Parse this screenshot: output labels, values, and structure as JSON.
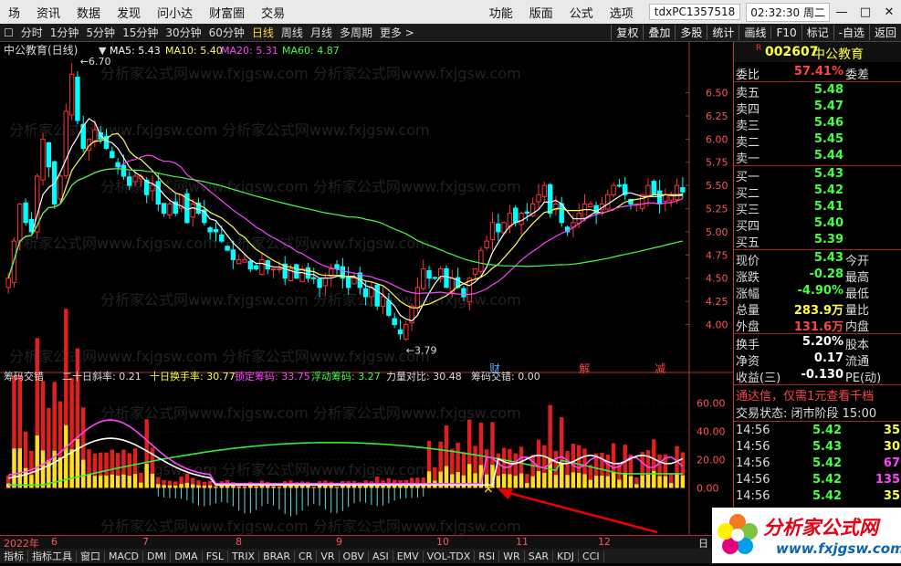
{
  "menu": [
    "场",
    "资讯",
    "数据",
    "发现",
    "问小达",
    "财富圈",
    "交易"
  ],
  "menu_right": [
    "功能",
    "版面",
    "公式",
    "选项"
  ],
  "account": "tdxPC1357518",
  "clock": "02:32:30 周二",
  "window_controls": [
    "—",
    "□",
    "✕"
  ],
  "periods": [
    "分时",
    "1分钟",
    "5分钟",
    "15分钟",
    "30分钟",
    "60分钟",
    "日线",
    "周线",
    "月线",
    "多周期",
    "更多 >"
  ],
  "active_period": "日线",
  "tools": [
    "复权",
    "叠加",
    "多股",
    "统计",
    "画线",
    "F10",
    "标记",
    "-自选",
    "返回"
  ],
  "stock_code": "002607",
  "stock_name": "中公教育",
  "kline_title": "中公教育(日线)",
  "ma": [
    {
      "label": "MA5: 5.43",
      "color": "#ffffff"
    },
    {
      "label": "MA10: 5.40",
      "color": "#ffff55"
    },
    {
      "label": "MA20: 5.31",
      "color": "#ff44ff"
    },
    {
      "label": "MA60: 4.87",
      "color": "#44ff44"
    }
  ],
  "high_mark": "6.70",
  "low_mark": "←3.79",
  "markers": [
    {
      "text": "财",
      "color": "#4da6ff",
      "date": "10月27日"
    },
    {
      "text": "解",
      "color": "#ff4444",
      "date": "11月17日"
    },
    {
      "text": "减",
      "color": "#ff4444",
      "date": "12月22日"
    }
  ],
  "indicator": {
    "name": "筹码交错",
    "items": [
      {
        "label": "二十日斜率: 0.21",
        "color": "#dddddd"
      },
      {
        "label": "十日换手率: 30.77",
        "color": "#ffff44"
      },
      {
        "label": "锁定筹码: 33.75",
        "color": "#ff44ff"
      },
      {
        "label": "浮动筹码: 3.27",
        "color": "#44ff44"
      },
      {
        "label": "力量对比: 30.48",
        "color": "#dddddd"
      },
      {
        "label": "筹码交错: 0.00",
        "color": "#dddddd"
      }
    ]
  },
  "price_axis": [
    "6.50",
    "6.25",
    "6.00",
    "5.75",
    "5.50",
    "5.25",
    "5.00",
    "4.75",
    "4.50",
    "4.25",
    "4.00"
  ],
  "ind_axis": [
    "60.00",
    "40.00",
    "20.00",
    "0.00"
  ],
  "date_axis": [
    "2022年",
    "6",
    "7",
    "8",
    "9",
    "10",
    "11",
    "12"
  ],
  "year_label": "日",
  "chart_data": {
    "type": "candlestick",
    "xlabel": "",
    "ylabel": "",
    "ylim": [
      3.7,
      6.85
    ],
    "x_ticks": [
      "2022年",
      "6",
      "7",
      "8",
      "9",
      "10",
      "11",
      "12"
    ],
    "price_path": [
      4.5,
      4.9,
      5.3,
      5.1,
      5.0,
      5.6,
      6.0,
      5.7,
      5.3,
      5.6,
      6.3,
      6.7,
      6.2,
      5.9,
      6.0,
      6.1,
      6.0,
      5.9,
      5.8,
      5.7,
      5.6,
      5.5,
      5.6,
      5.6,
      5.4,
      5.5,
      5.3,
      5.2,
      5.3,
      5.2,
      5.4,
      5.1,
      5.3,
      5.2,
      5.1,
      5.0,
      5.0,
      4.9,
      4.8,
      4.7,
      4.7,
      4.7,
      4.6,
      4.6,
      4.7,
      4.6,
      4.6,
      4.6,
      4.5,
      4.6,
      4.5,
      4.6,
      4.5,
      4.5,
      4.4,
      4.5,
      4.6,
      4.6,
      4.5,
      4.4,
      4.5,
      4.4,
      4.3,
      4.4,
      4.2,
      4.3,
      4.1,
      4.0,
      3.9,
      4.0,
      4.2,
      4.4,
      4.6,
      4.5,
      4.5,
      4.6,
      4.4,
      4.5,
      4.4,
      4.3,
      4.5,
      4.6,
      4.8,
      4.9,
      5.1,
      5.0,
      5.1,
      5.2,
      5.1,
      5.2,
      5.2,
      5.3,
      5.4,
      5.5,
      5.2,
      5.3,
      5.1,
      5.0,
      5.1,
      5.2,
      5.3,
      5.3,
      5.2,
      5.3,
      5.4,
      5.5,
      5.5,
      5.4,
      5.3,
      5.3,
      5.4,
      5.5,
      5.4,
      5.3,
      5.4,
      5.4,
      5.5,
      5.43
    ],
    "ma_series": [
      "MA5",
      "MA10",
      "MA20",
      "MA60"
    ],
    "indicator_ylim": [
      -30,
      75
    ]
  },
  "quote": {
    "weibi_label": "委比",
    "weibi_value": "57.41%",
    "weicha_label": "委差",
    "asks": [
      {
        "label": "卖五",
        "price": "5.48"
      },
      {
        "label": "卖四",
        "price": "5.47"
      },
      {
        "label": "卖三",
        "price": "5.46"
      },
      {
        "label": "卖二",
        "price": "5.45"
      },
      {
        "label": "卖一",
        "price": "5.44"
      }
    ],
    "bids": [
      {
        "label": "买一",
        "price": "5.43"
      },
      {
        "label": "买二",
        "price": "5.42"
      },
      {
        "label": "买三",
        "price": "5.41"
      },
      {
        "label": "买四",
        "price": "5.40"
      },
      {
        "label": "买五",
        "price": "5.39"
      }
    ],
    "stats": [
      {
        "label": "现价",
        "value": "5.43",
        "right": "今开",
        "color": "#44ff44"
      },
      {
        "label": "涨跌",
        "value": "-0.28",
        "right": "最高",
        "color": "#44ff44"
      },
      {
        "label": "涨幅",
        "value": "-4.90%",
        "right": "最低",
        "color": "#44ff44"
      },
      {
        "label": "总量",
        "value": "283.9万",
        "right": "量比",
        "color": "#ffff44"
      },
      {
        "label": "外盘",
        "value": "131.6万",
        "right": "内盘",
        "color": "#ff4444"
      }
    ],
    "stats2": [
      {
        "label": "换手",
        "value": "5.20%",
        "right": "股本",
        "color": "#ffffff"
      },
      {
        "label": "净资",
        "value": "0.17",
        "right": "流通",
        "color": "#ffffff"
      },
      {
        "label": "收益(三)",
        "value": "-0.130",
        "right": "PE(动)",
        "color": "#ffffff"
      }
    ],
    "promo": "通达信，仅需1元查看千档",
    "trade_status": "交易状态: 闭市阶段 15:00",
    "ticks": [
      {
        "time": "14:56",
        "price": "5.42",
        "vol": "35",
        "vc": "#ffff44"
      },
      {
        "time": "14:56",
        "price": "5.43",
        "vol": "30",
        "vc": "#ffff44"
      },
      {
        "time": "14:56",
        "price": "5.42",
        "vol": "67",
        "vc": "#ff44ff"
      },
      {
        "time": "14:56",
        "price": "5.42",
        "vol": "135",
        "vc": "#ff44ff"
      },
      {
        "time": "14:56",
        "price": "5.42",
        "vol": "35",
        "vc": "#ffff44"
      }
    ]
  },
  "idx_tabs": [
    "指标",
    "指标工具",
    "窗口",
    "MACD",
    "DMI",
    "DMA",
    "FSL",
    "TRIX",
    "BRAR",
    "CR",
    "VR",
    "OBV",
    "ASI",
    "EMV",
    "VOL-TDX",
    "RSI",
    "WR",
    "SAR",
    "KDJ",
    "CCI"
  ],
  "logo": {
    "brand": "分析家公式网",
    "url": "www.fxjgsw.com"
  },
  "watermark": "分析家公式网www.fxjgsw.com"
}
